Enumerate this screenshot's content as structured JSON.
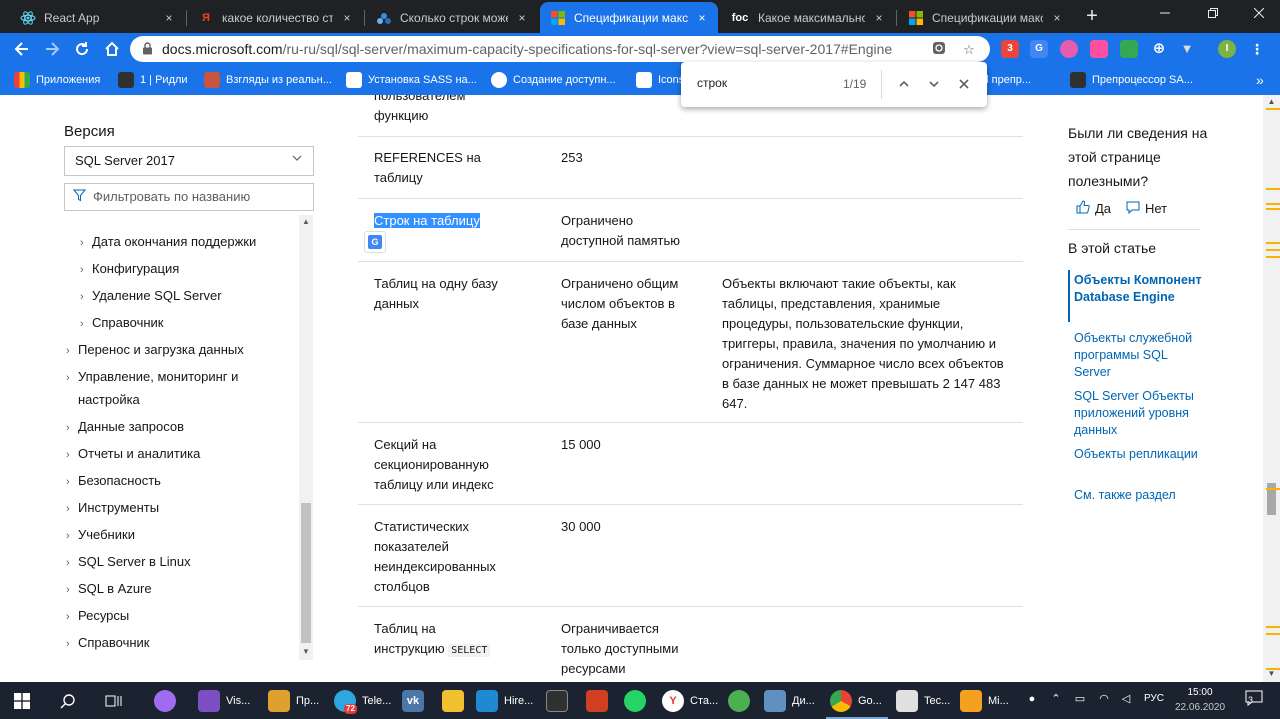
{
  "browser": {
    "tabs": [
      {
        "label": "React App",
        "icon": "react-icon",
        "active": false
      },
      {
        "label": "какое количество стро",
        "icon": "yandex-icon",
        "active": false
      },
      {
        "label": "Сколько строк может ",
        "icon": "stackoverflow-icon",
        "active": false
      },
      {
        "label": "Спецификации максим",
        "icon": "microsoft-icon",
        "active": true
      },
      {
        "label": "Какое максимальное к",
        "icon": "foc-icon",
        "active": false
      },
      {
        "label": "Спецификации максим",
        "icon": "microsoft-icon",
        "active": false
      }
    ],
    "tab_close_glyph": "×",
    "newtab_glyph": "+",
    "foc_text": "foc",
    "url_host": "docs.microsoft.com",
    "url_path": "/ru-ru/sql/sql-server/maximum-capacity-specifications-for-sql-server?view=sql-server-2017#Engine",
    "extension_badge": "3",
    "profile_initial": "I",
    "bookmarks": [
      {
        "label": "Приложения",
        "color": "#e8453c"
      },
      {
        "label": "1 | Ридли",
        "color": "#303030"
      },
      {
        "label": "Взгляды из реальн...",
        "color": "#c8553d"
      },
      {
        "label": "Установка SASS на...",
        "color": "#ffffff"
      },
      {
        "label": "Создание доступн...",
        "color": "#ffffff"
      },
      {
        "label": "Icons",
        "color": "#ffffff"
      },
      {
        "label": "Html препр...",
        "color": "#ffffff"
      },
      {
        "label": "Препроцессор SA...",
        "color": "#303030"
      }
    ],
    "bookmarks_more": "»"
  },
  "find": {
    "query": "строк",
    "count": "1/19"
  },
  "leftnav": {
    "version_label": "Версия",
    "version_value": "SQL Server 2017",
    "filter_placeholder": "Фильтровать по названию",
    "items": [
      {
        "label": "Дата окончания поддержки",
        "level": 2
      },
      {
        "label": "Конфигурация",
        "level": 2
      },
      {
        "label": "Удаление SQL Server",
        "level": 2
      },
      {
        "label": "Справочник",
        "level": 2
      },
      {
        "label": "Перенос и загрузка данных",
        "level": 1
      },
      {
        "label": "Управление, мониторинг и",
        "level": 1
      },
      {
        "label": "настройка",
        "level": 1,
        "continuation": true
      },
      {
        "label": "Данные запросов",
        "level": 1
      },
      {
        "label": "Отчеты и аналитика",
        "level": 1
      },
      {
        "label": "Безопасность",
        "level": 1
      },
      {
        "label": "Инструменты",
        "level": 1
      },
      {
        "label": "Учебники",
        "level": 1
      },
      {
        "label": "SQL Server в Linux",
        "level": 1
      },
      {
        "label": "SQL в Azure",
        "level": 1
      },
      {
        "label": "Ресурсы",
        "level": 1
      },
      {
        "label": "Справочник",
        "level": 1
      }
    ]
  },
  "table": {
    "top_fragment": [
      "пользователем",
      "функцию"
    ],
    "rows": [
      {
        "object": [
          "REFERENCES на",
          "таблицу"
        ],
        "limit": [
          "253"
        ],
        "note": []
      },
      {
        "object": [
          "Строк на таблицу"
        ],
        "limit": [
          "Ограничено",
          "доступной памятью"
        ],
        "note": []
      },
      {
        "object": [
          "Таблиц на одну базу",
          "данных"
        ],
        "limit": [
          "Ограничено общим",
          "числом объектов в",
          "базе данных"
        ],
        "note": [
          "Объекты включают такие объекты, как",
          "таблицы, представления, хранимые",
          "процедуры, пользовательские функции,",
          "триггеры, правила, значения по умолчанию и",
          "ограничения. Суммарное число всех объектов",
          "в базе данных не может превышать 2 147 483",
          "647."
        ]
      },
      {
        "object": [
          "Секций на",
          "секционированную",
          "таблицу или индекс"
        ],
        "limit": [
          "15 000"
        ],
        "note": []
      },
      {
        "object": [
          "Статистических",
          "показателей",
          "неиндексированных",
          "столбцов"
        ],
        "limit": [
          "30 000"
        ],
        "note": []
      },
      {
        "object": [
          "Таблиц на",
          "инструкцию"
        ],
        "limit": [
          "Ограничивается",
          "только доступными",
          "ресурсами"
        ],
        "note": []
      }
    ],
    "highlight_match": "Строк",
    "highlight_rest": " на таблицу",
    "select_keyword": "SELECT"
  },
  "rightcol": {
    "feedback_question": "Были ли сведения на этой странице полезными?",
    "yes": "Да",
    "no": "Нет",
    "toc_heading": "В этой статье",
    "links": [
      {
        "label": "Объекты Компонент Database Engine",
        "active": true
      },
      {
        "label": "Объекты служебной программы SQL Server",
        "active": false
      },
      {
        "label": "SQL Server Объекты приложений уровня данных",
        "active": false
      },
      {
        "label": "Объекты репликации",
        "active": false
      },
      {
        "label": "См. также раздел",
        "active": false
      }
    ]
  },
  "taskbar": {
    "items": [
      {
        "label": "Vis...",
        "color": "#7d4fc5"
      },
      {
        "label": "Пр...",
        "color": "#e0a030"
      },
      {
        "label": "Tele...",
        "color": "#2ea6e0"
      },
      {
        "label": "",
        "color": "#4a76a8"
      },
      {
        "label": "",
        "color": "#f0c030"
      },
      {
        "label": "Hire...",
        "color": "#1f8ad2"
      },
      {
        "label": "",
        "color": "#303030"
      },
      {
        "label": "",
        "color": "#d04020"
      },
      {
        "label": "",
        "color": "#25d366"
      },
      {
        "label": "Ста...",
        "color": "#ffffff"
      },
      {
        "label": "",
        "color": "#4caf50"
      },
      {
        "label": "Ди...",
        "color": "#6090c0"
      },
      {
        "label": "Go...",
        "color": "#ffffff"
      },
      {
        "label": "Tec...",
        "color": "#e0e0e0"
      },
      {
        "label": "Mi...",
        "color": "#f4a020"
      }
    ],
    "telegram_badge": "72",
    "notif_badge": "3",
    "lang": "РУС",
    "time": "15:00",
    "date": "22.06.2020"
  }
}
